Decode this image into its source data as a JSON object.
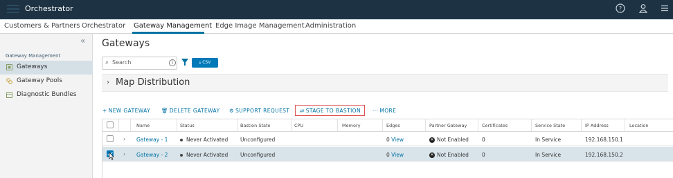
{
  "app": {
    "title": "Orchestrator"
  },
  "header_icons": [
    "help-icon",
    "user-icon",
    "menu-icon"
  ],
  "nav": {
    "tabs": [
      {
        "label": "Customers & Partners"
      },
      {
        "label": "Orchestrator"
      },
      {
        "label": "Gateway Management"
      },
      {
        "label": "Edge Image Management"
      },
      {
        "label": "Administration"
      }
    ],
    "active": "Gateway Management"
  },
  "sidebar": {
    "heading": "Gateway Management",
    "items": [
      {
        "label": "Gateways",
        "icon": "gateway-icon"
      },
      {
        "label": "Gateway Pools",
        "icon": "gateway-pool-icon"
      },
      {
        "label": "Diagnostic Bundles",
        "icon": "bundle-icon"
      }
    ],
    "active": "Gateways"
  },
  "main": {
    "title": "Gateways",
    "search": {
      "placeholder": "Search",
      "value": ""
    },
    "csv_label": "CSV",
    "map_section": "Map Distribution",
    "actions": {
      "new": "NEW GATEWAY",
      "delete": "DELETE GATEWAY",
      "support": "SUPPORT REQUEST",
      "stage": "STAGE TO BASTION",
      "more": "MORE"
    },
    "table": {
      "columns": [
        "Name",
        "Status",
        "Bastion State",
        "CPU",
        "Memory",
        "Edges",
        "Partner Gateway",
        "Certificates",
        "Service State",
        "IP Address",
        "Location"
      ],
      "rows": [
        {
          "name": "Gateway - 1",
          "status": "Never Activated",
          "bastion": "Unconfigured",
          "cpu": "",
          "memory": "",
          "edges_count": "0",
          "edges_link": "View",
          "partner": "Not Enabled",
          "certificates": "0",
          "service": "In Service",
          "ip": "192.168.150.1",
          "location": "",
          "checked": false
        },
        {
          "name": "Gateway - 2",
          "status": "Never Activated",
          "bastion": "Unconfigured",
          "cpu": "",
          "memory": "",
          "edges_count": "0",
          "edges_link": "View",
          "partner": "Not Enabled",
          "certificates": "0",
          "service": "In Service",
          "ip": "192.168.150.2",
          "location": "",
          "checked": true
        }
      ]
    }
  },
  "colors": {
    "topbar": "#1d3344",
    "accent": "#0072a3",
    "highlight": "#e05252",
    "selected_row": "#d9e4ea"
  }
}
